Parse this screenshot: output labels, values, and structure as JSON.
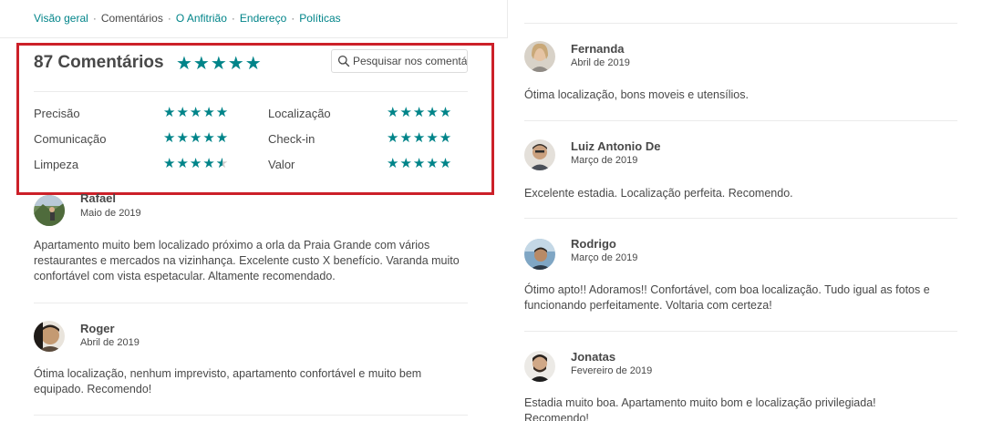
{
  "nav": {
    "items": [
      {
        "label": "Visão geral",
        "current": false
      },
      {
        "label": "Comentários",
        "current": true
      },
      {
        "label": "O Anfitrião",
        "current": false
      },
      {
        "label": "Endereço",
        "current": false
      },
      {
        "label": "Políticas",
        "current": false
      }
    ],
    "separator": "·"
  },
  "summary": {
    "title": "87 Comentários",
    "overall_stars": "★★★★★",
    "overall_rating": 5,
    "search_placeholder": "Pesquisar nos comentários",
    "categories": [
      {
        "label": "Precisão",
        "rating": 5,
        "stars": "★★★★★"
      },
      {
        "label": "Localização",
        "rating": 5,
        "stars": "★★★★★"
      },
      {
        "label": "Comunicação",
        "rating": 5,
        "stars": "★★★★★"
      },
      {
        "label": "Check-in",
        "rating": 5,
        "stars": "★★★★★"
      },
      {
        "label": "Limpeza",
        "rating": 4.5,
        "stars": "★★★★★"
      },
      {
        "label": "Valor",
        "rating": 5,
        "stars": "★★★★★"
      }
    ]
  },
  "reviews": [
    {
      "name": "Rafael",
      "date": "Maio de 2019",
      "text": "Apartamento muito bem localizado próximo a orla da Praia Grande com vários restaurantes e mercados na vizinhança. Excelente custo X benefício. Varanda muito confortável com vista espetacular. Altamente recomendado."
    },
    {
      "name": "Roger",
      "date": "Abril de 2019",
      "text": "Ótima localização, nenhum imprevisto, apartamento confortável e muito bem equipado. Recomendo!"
    },
    {
      "name": "Fernanda",
      "date": "Abril de 2019",
      "text": "Ótima localização, bons moveis e utensílios."
    },
    {
      "name": "Luiz Antonio De",
      "date": "Março de 2019",
      "text": "Excelente estadia. Localização perfeita. Recomendo."
    },
    {
      "name": "Rodrigo",
      "date": "Março de 2019",
      "text": "Ótimo apto!! Adoramos!! Confortável, com boa localização. Tudo igual as fotos e funcionando perfeitamente. Voltaria com certeza!"
    },
    {
      "name": "Jonatas",
      "date": "Fevereiro de 2019",
      "text": "Estadia muito boa. Apartamento muito bom e localização privilegiada! Recomendo!"
    }
  ],
  "colors": {
    "accent": "#008489",
    "text": "#484848",
    "highlight": "#cc2029",
    "divider": "#ebebeb"
  }
}
